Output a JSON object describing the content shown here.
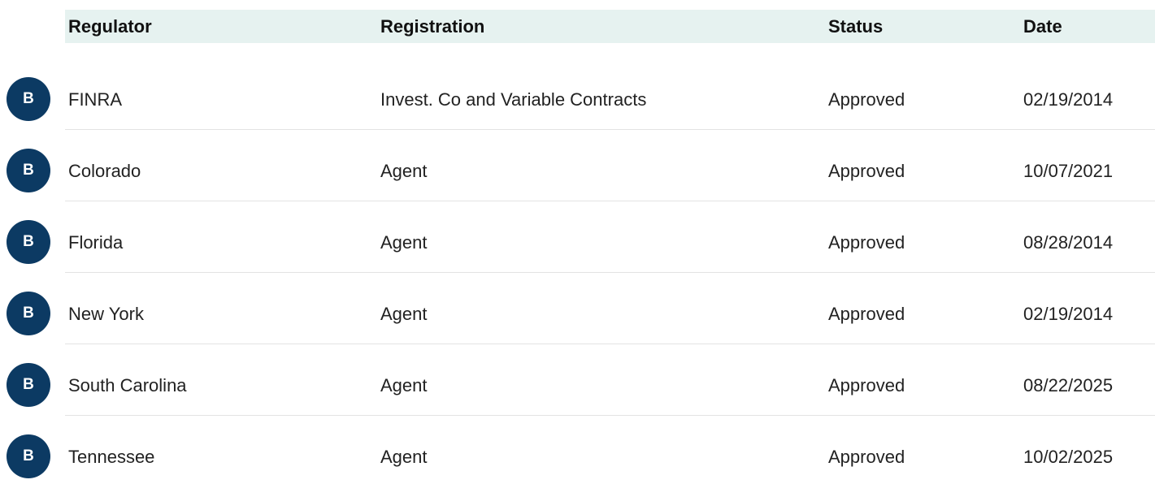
{
  "table": {
    "headers": {
      "regulator": "Regulator",
      "registration": "Registration",
      "status": "Status",
      "date": "Date"
    },
    "rows": [
      {
        "badge": "B",
        "regulator": "FINRA",
        "registration": "Invest. Co and Variable Contracts",
        "status": "Approved",
        "date": "02/19/2014"
      },
      {
        "badge": "B",
        "regulator": "Colorado",
        "registration": "Agent",
        "status": "Approved",
        "date": "10/07/2021"
      },
      {
        "badge": "B",
        "regulator": "Florida",
        "registration": "Agent",
        "status": "Approved",
        "date": "08/28/2014"
      },
      {
        "badge": "B",
        "regulator": "New York",
        "registration": "Agent",
        "status": "Approved",
        "date": "02/19/2014"
      },
      {
        "badge": "B",
        "regulator": "South Carolina",
        "registration": "Agent",
        "status": "Approved",
        "date": "08/22/2025"
      },
      {
        "badge": "B",
        "regulator": "Tennessee",
        "registration": "Agent",
        "status": "Approved",
        "date": "10/02/2025"
      }
    ]
  },
  "colors": {
    "header_bg": "#e6f2f0",
    "badge_bg": "#0c3a63",
    "badge_text": "#ffffff",
    "divider": "#e3e3e3"
  }
}
